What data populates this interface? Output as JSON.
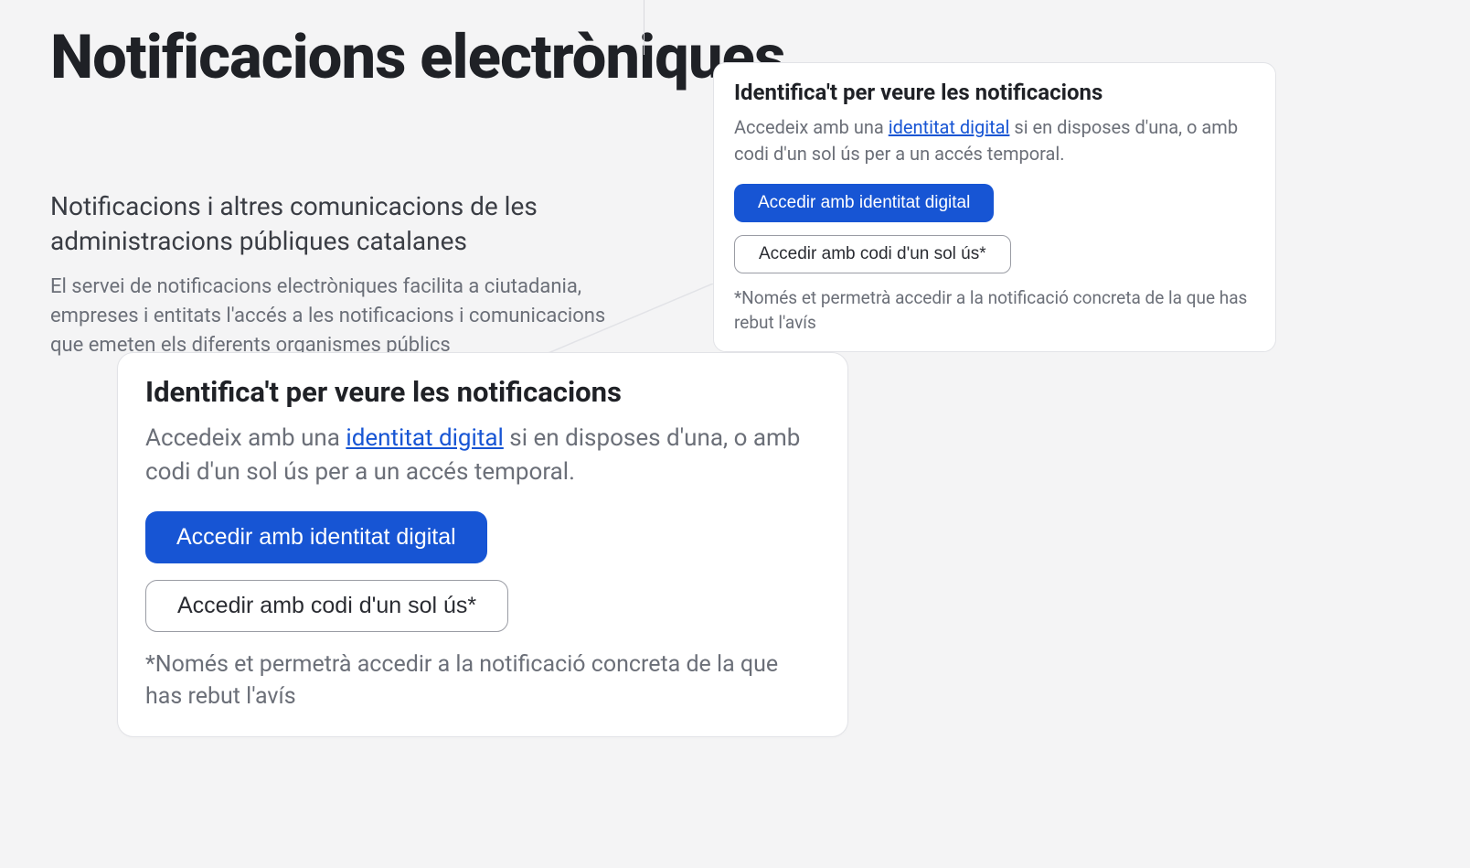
{
  "page": {
    "title": "Notificacions electròniques",
    "subtitle": "Notificacions i altres comunicacions de les administracions públiques catalanes",
    "description": "El servei de notificacions electròniques facilita a ciutadania, empreses i entitats l'accés a les notificacions i comunicacions que emeten els diferents organismes públics"
  },
  "card": {
    "title": "Identifica't per veure les notificacions",
    "desc_prefix": "Accedeix amb una ",
    "desc_link": "identitat digital",
    "desc_suffix": " si en disposes d'una, o amb codi d'un sol ús per a un accés temporal.",
    "btn_primary": "Accedir amb identitat digital",
    "btn_secondary": "Accedir amb codi d'un sol ús*",
    "note": "*Només et permetrà accedir a la notificació concreta de la que has rebut l'avís"
  }
}
